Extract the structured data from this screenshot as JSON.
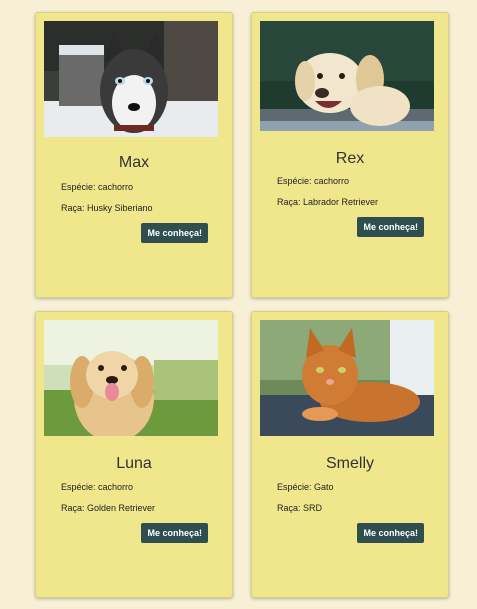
{
  "cards": [
    {
      "name": "Max",
      "species_label": "Espécie: ",
      "species": "cachorro",
      "breed_label": "Raça: ",
      "breed": "Husky Siberiano",
      "button": "Me conheça!",
      "photo_icon": "husky-photo"
    },
    {
      "name": "Rex",
      "species_label": "Espécie: ",
      "species": "cachorro",
      "breed_label": "Raça: ",
      "breed": "Labrador Retriever",
      "button": "Me conheça!",
      "photo_icon": "labrador-photo"
    },
    {
      "name": "Luna",
      "species_label": "Espécie: ",
      "species": "cachorro",
      "breed_label": "Raça: ",
      "breed": "Golden Retriever",
      "button": "Me conheça!",
      "photo_icon": "golden-retriever-photo"
    },
    {
      "name": "Smelly",
      "species_label": "Espécie: ",
      "species": "Gato",
      "breed_label": "Raça: ",
      "breed": "SRD",
      "button": "Me conheça!",
      "photo_icon": "cat-photo"
    }
  ],
  "colors": {
    "page_bg": "#f7f0d6",
    "card_bg": "#f0e68c",
    "button_bg": "#2f4f4f",
    "button_text": "#ffffff"
  }
}
